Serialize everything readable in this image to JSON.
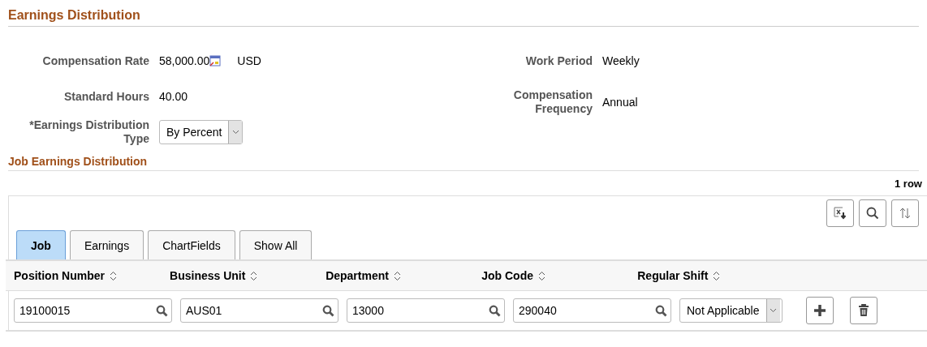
{
  "section_title": "Earnings Distribution",
  "fields_left": [
    {
      "label": "Compensation Rate",
      "value": "58,000.00",
      "unit": "USD",
      "kind": "rate"
    },
    {
      "label": "Standard Hours",
      "value": "40.00",
      "kind": "text"
    },
    {
      "label": "*Earnings Distribution Type",
      "value": "By Percent",
      "kind": "select"
    }
  ],
  "fields_right": [
    {
      "label": "Work Period",
      "value": "Weekly",
      "kind": "text"
    },
    {
      "label": "Compensation Frequency",
      "value": "Annual",
      "kind": "text"
    }
  ],
  "grid_title": "Job Earnings Distribution",
  "row_count": "1 row",
  "tabs": [
    {
      "label": "Job",
      "selected": true
    },
    {
      "label": "Earnings",
      "selected": false
    },
    {
      "label": "ChartFields",
      "selected": false
    },
    {
      "label": "Show All",
      "selected": false
    }
  ],
  "columns": [
    "Position Number",
    "Business Unit",
    "Department",
    "Job Code",
    "Regular Shift"
  ],
  "rows": [
    {
      "cells": [
        {
          "value": "19100015",
          "kind": "lookup"
        },
        {
          "value": "AUS01",
          "kind": "lookup"
        },
        {
          "value": "13000",
          "kind": "lookup"
        },
        {
          "value": "290040",
          "kind": "lookup"
        },
        {
          "value": "Not Applicable",
          "kind": "select"
        }
      ]
    }
  ]
}
